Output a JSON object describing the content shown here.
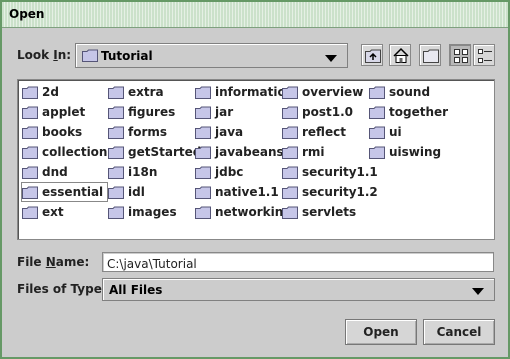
{
  "window": {
    "title": "Open"
  },
  "look_in": {
    "label_pre": "Look ",
    "label_mnemonic": "I",
    "label_post": "n:",
    "value": "Tutorial"
  },
  "toolbar": {
    "buttons": [
      "up-one-level",
      "home",
      "create-new-folder",
      "list-view",
      "details-view"
    ]
  },
  "files": [
    "2d",
    "applet",
    "books",
    "collections",
    "dnd",
    "essential",
    "ext",
    "extra",
    "figures",
    "forms",
    "getStarted",
    "i18n",
    "idl",
    "images",
    "information",
    "jar",
    "java",
    "javabeans",
    "jdbc",
    "native1.1",
    "networking",
    "overview",
    "post1.0",
    "reflect",
    "rmi",
    "security1.1",
    "security1.2",
    "servlets",
    "sound",
    "together",
    "ui",
    "uiswing"
  ],
  "selected_file": "essential",
  "file_name": {
    "label_pre": "File ",
    "label_mnemonic": "N",
    "label_post": "ame:",
    "value": "C:\\java\\Tutorial"
  },
  "files_of_type": {
    "label": "Files of Type:",
    "value": "All Files"
  },
  "actions": {
    "open": "Open",
    "cancel": "Cancel"
  },
  "colors": {
    "title_bar": "#cbe1ca",
    "window_border": "#669966",
    "dialog_bg": "#cccccc",
    "folder_fill": "#c6c6e8"
  }
}
